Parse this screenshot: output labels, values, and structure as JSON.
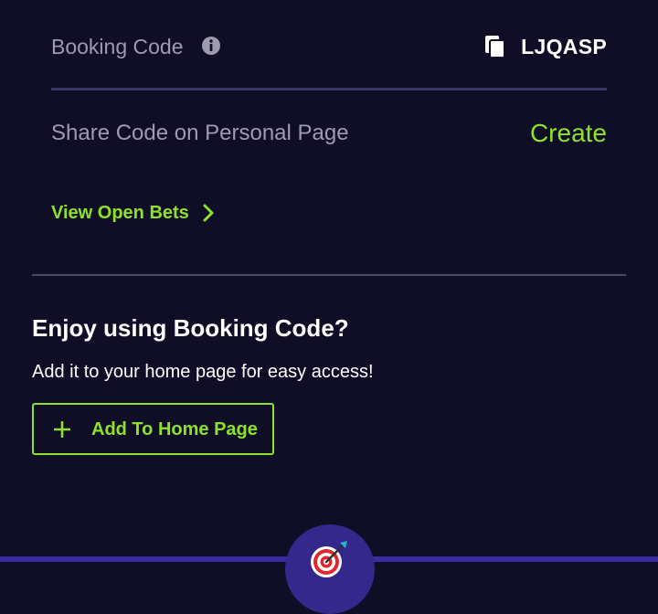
{
  "booking": {
    "label": "Booking Code",
    "code": "LJQASP"
  },
  "share": {
    "label": "Share Code on Personal Page",
    "action": "Create"
  },
  "open_bets": {
    "label": "View Open Bets"
  },
  "promo": {
    "title": "Enjoy using Booking Code?",
    "text": "Add it to your home page for easy access!",
    "button_label": "Add To Home Page"
  },
  "colors": {
    "background": "#100d27",
    "accent": "#8ee22b",
    "muted_text": "#9d9bb0",
    "divider": "#3a3565",
    "fab": "#35288c"
  },
  "icons": [
    "info-icon",
    "copy-icon",
    "chevron-right-icon",
    "plus-icon",
    "target-icon"
  ]
}
